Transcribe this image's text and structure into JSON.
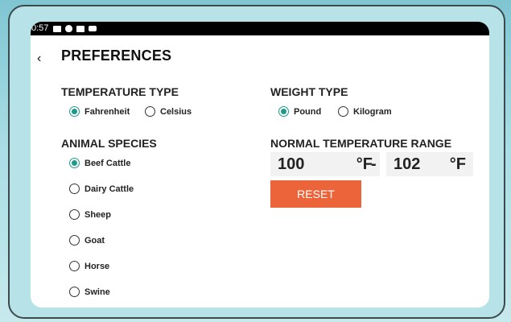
{
  "status_bar": {
    "time": "0:57"
  },
  "header": {
    "title": "PREFERENCES",
    "back_glyph": "‹"
  },
  "temperature_type": {
    "label": "TEMPERATURE TYPE",
    "options": [
      {
        "label": "Fahrenheit",
        "selected": true
      },
      {
        "label": "Celsius",
        "selected": false
      }
    ]
  },
  "weight_type": {
    "label": "WEIGHT TYPE",
    "options": [
      {
        "label": "Pound",
        "selected": true
      },
      {
        "label": "Kilogram",
        "selected": false
      }
    ]
  },
  "animal_species": {
    "label": "ANIMAL SPECIES",
    "options": [
      {
        "label": "Beef Cattle",
        "selected": true
      },
      {
        "label": "Dairy Cattle",
        "selected": false
      },
      {
        "label": "Sheep",
        "selected": false
      },
      {
        "label": "Goat",
        "selected": false
      },
      {
        "label": "Horse",
        "selected": false
      },
      {
        "label": "Swine",
        "selected": false
      }
    ]
  },
  "normal_temperature_range": {
    "label": "NORMAL TEMPERATURE RANGE",
    "min": "100",
    "max": "102",
    "unit": "°F",
    "separator": "-"
  },
  "reset_label": "RESET",
  "colors": {
    "accent": "#1f9a8a",
    "reset_button": "#ec6439"
  }
}
